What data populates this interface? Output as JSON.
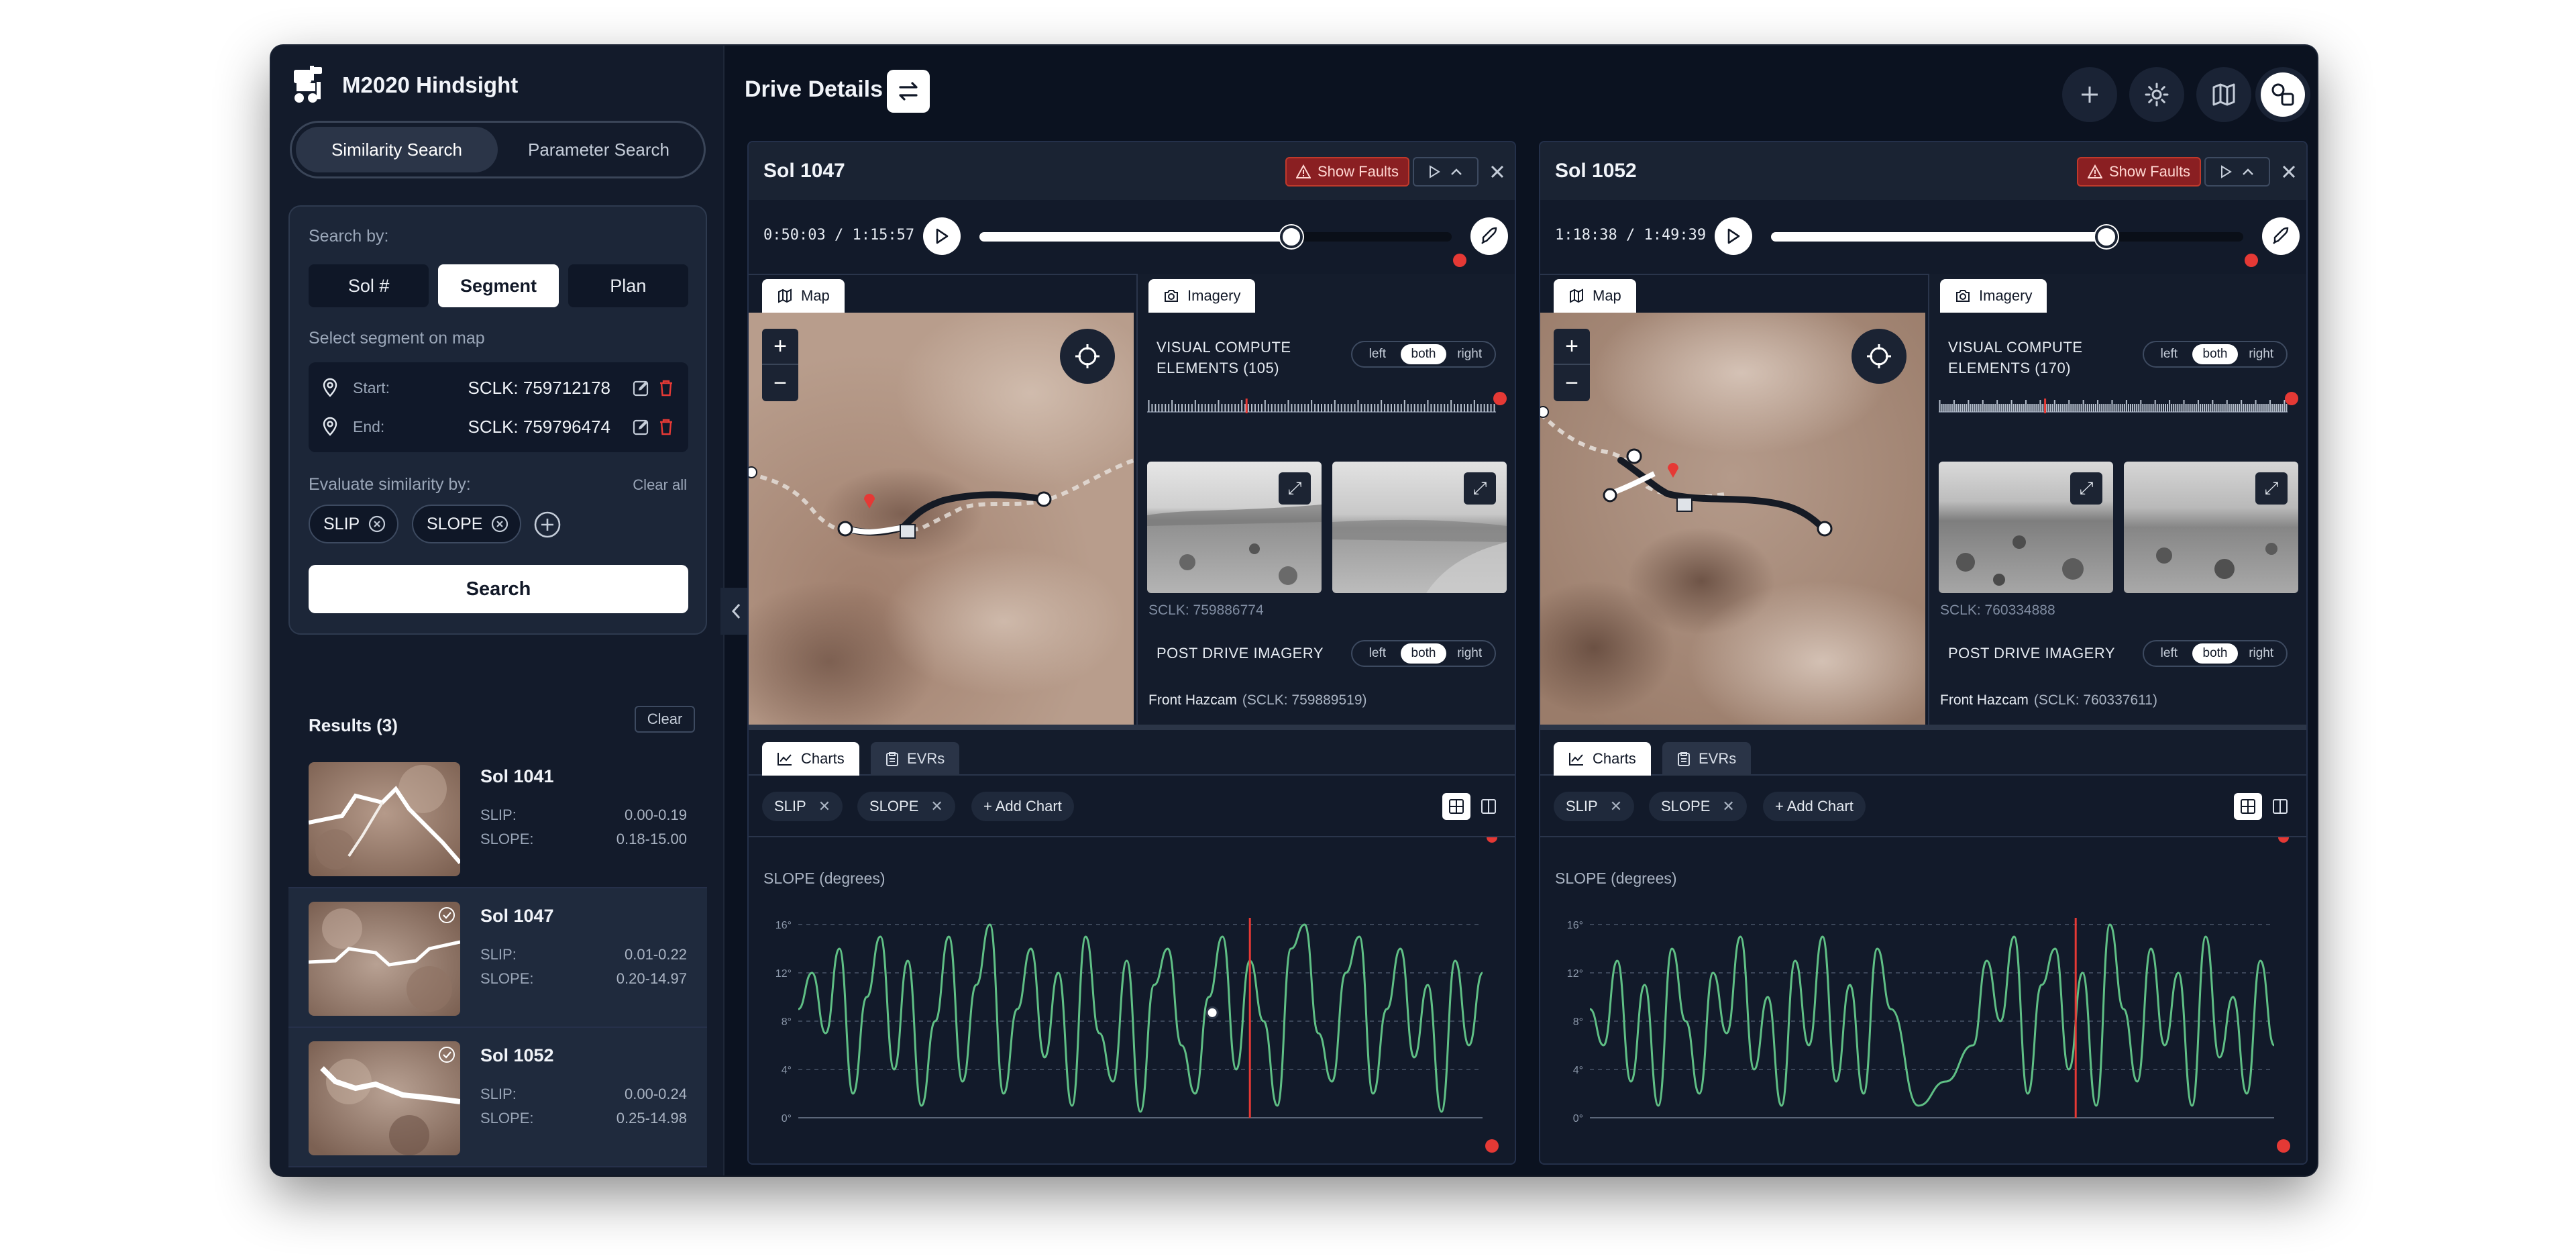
{
  "app": {
    "name": "M2020 Hindsight"
  },
  "mode_tabs": [
    "Similarity Search",
    "Parameter Search"
  ],
  "search": {
    "search_by_label": "Search by:",
    "options": [
      "Sol #",
      "Segment",
      "Plan"
    ],
    "select_segment_label": "Select segment on map",
    "start_label": "Start:",
    "start_value": "SCLK: 759712178",
    "end_label": "End:",
    "end_value": "SCLK: 759796474",
    "evaluate_label": "Evaluate similarity by:",
    "clear_all": "Clear all",
    "chips": [
      "SLIP",
      "SLOPE"
    ],
    "button": "Search"
  },
  "results": {
    "header": "Results (3)",
    "clear": "Clear",
    "items": [
      {
        "title": "Sol 1041",
        "slip_label": "SLIP:",
        "slip": "0.00-0.19",
        "slope_label": "SLOPE:",
        "slope": "0.18-15.00"
      },
      {
        "title": "Sol 1047",
        "slip_label": "SLIP:",
        "slip": "0.01-0.22",
        "slope_label": "SLOPE:",
        "slope": "0.20-14.97"
      },
      {
        "title": "Sol 1052",
        "slip_label": "SLIP:",
        "slip": "0.00-0.24",
        "slope_label": "SLOPE:",
        "slope": "0.25-14.98"
      }
    ]
  },
  "topbar": {
    "title": "Drive Details"
  },
  "panels": [
    {
      "title": "Sol 1047",
      "show_faults": "Show Faults",
      "time": "0:50:03 / 1:15:57",
      "progress": 0.66,
      "map_tab": "Map",
      "imagery_tab": "Imagery",
      "vce_line1": "VISUAL COMPUTE",
      "vce_line2": "ELEMENTS (105)",
      "toggle": [
        "left",
        "both",
        "right"
      ],
      "image_sclk": "SCLK: 759886774",
      "post_drive": "POST DRIVE IMAGERY",
      "front_hazcam": "Front Hazcam",
      "front_sclk": "(SCLK: 759889519)",
      "tabs": [
        "Charts",
        "EVRs"
      ],
      "chips": [
        "SLIP",
        "SLOPE"
      ],
      "add_chart": "+ Add Chart",
      "chart_title": "SLOPE (degrees)"
    },
    {
      "title": "Sol 1052",
      "show_faults": "Show Faults",
      "time": "1:18:38 / 1:49:39",
      "progress": 0.71,
      "map_tab": "Map",
      "imagery_tab": "Imagery",
      "vce_line1": "VISUAL COMPUTE",
      "vce_line2": "ELEMENTS (170)",
      "toggle": [
        "left",
        "both",
        "right"
      ],
      "image_sclk": "SCLK: 760334888",
      "post_drive": "POST DRIVE IMAGERY",
      "front_hazcam": "Front Hazcam",
      "front_sclk": "(SCLK: 760337611)",
      "tabs": [
        "Charts",
        "EVRs"
      ],
      "chips": [
        "SLIP",
        "SLOPE"
      ],
      "add_chart": "+ Add Chart",
      "chart_title": "SLOPE (degrees)"
    }
  ],
  "chart_data": [
    {
      "type": "line",
      "title": "SLOPE (degrees)",
      "y_ticks": [
        "0°",
        "4°",
        "8°",
        "12°",
        "16°"
      ],
      "ylim": [
        0,
        16
      ],
      "xlim": [
        0,
        1
      ],
      "grid": true,
      "color": "#5fbf85",
      "cursor_x": 0.66,
      "marker": {
        "x": 0.605,
        "y": 8.7
      },
      "x": [
        0,
        0.02,
        0.04,
        0.06,
        0.08,
        0.1,
        0.12,
        0.14,
        0.16,
        0.18,
        0.2,
        0.22,
        0.24,
        0.26,
        0.28,
        0.3,
        0.32,
        0.34,
        0.36,
        0.38,
        0.4,
        0.42,
        0.44,
        0.46,
        0.48,
        0.5,
        0.52,
        0.54,
        0.56,
        0.58,
        0.6,
        0.62,
        0.64,
        0.66,
        0.68,
        0.7,
        0.72,
        0.74,
        0.76,
        0.78,
        0.8,
        0.82,
        0.84,
        0.86,
        0.88,
        0.9,
        0.92,
        0.94,
        0.96,
        0.98,
        1.0
      ],
      "y": [
        9,
        12,
        7,
        14,
        2,
        10,
        15,
        4,
        13,
        1,
        8,
        15,
        3,
        11,
        16,
        2,
        9,
        14,
        5,
        12,
        1,
        15,
        7,
        3,
        13,
        0.5,
        11,
        14,
        6,
        2,
        10,
        15,
        4,
        13,
        8,
        1,
        14,
        16,
        7,
        3,
        12,
        15,
        2,
        9,
        14,
        5,
        11,
        0.5,
        13,
        6,
        12
      ]
    },
    {
      "type": "line",
      "title": "SLOPE (degrees)",
      "y_ticks": [
        "0°",
        "4°",
        "8°",
        "12°",
        "16°"
      ],
      "ylim": [
        0,
        16
      ],
      "xlim": [
        0,
        1
      ],
      "grid": true,
      "color": "#5fbf85",
      "cursor_x": 0.71,
      "x": [
        0,
        0.02,
        0.04,
        0.06,
        0.08,
        0.1,
        0.12,
        0.14,
        0.16,
        0.18,
        0.2,
        0.22,
        0.24,
        0.26,
        0.28,
        0.3,
        0.32,
        0.34,
        0.36,
        0.38,
        0.4,
        0.42,
        0.44,
        0.48,
        0.52,
        0.56,
        0.58,
        0.6,
        0.62,
        0.64,
        0.66,
        0.68,
        0.7,
        0.72,
        0.74,
        0.76,
        0.78,
        0.8,
        0.82,
        0.84,
        0.86,
        0.88,
        0.9,
        0.92,
        0.94,
        0.96,
        0.98,
        1.0
      ],
      "y": [
        9,
        6,
        13,
        3,
        11,
        1,
        14,
        8,
        2,
        12,
        7,
        15,
        4,
        10,
        1,
        13,
        6,
        15,
        3,
        11,
        2,
        14,
        9,
        1,
        3,
        6,
        13,
        8,
        15,
        2,
        11,
        14,
        4,
        12,
        1,
        16,
        9,
        3,
        14,
        6,
        12,
        1,
        15,
        5,
        10,
        2,
        13,
        6
      ]
    }
  ]
}
